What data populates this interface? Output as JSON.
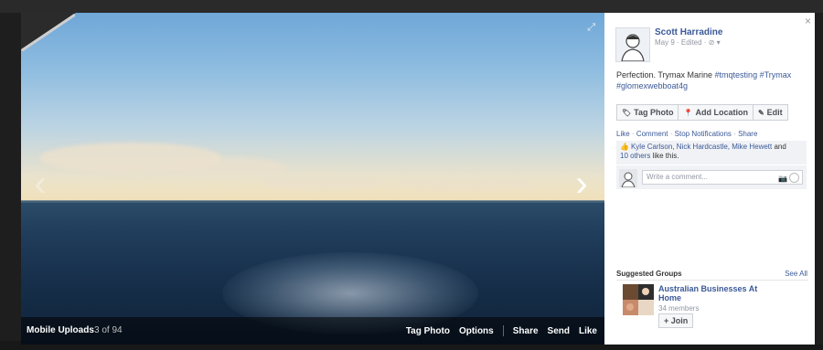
{
  "photo": {
    "album_label": "Mobile Uploads",
    "counter": "3 of 94",
    "actions": [
      "Tag Photo",
      "Options",
      "Share",
      "Send",
      "Like"
    ]
  },
  "post": {
    "author": "Scott Harradine",
    "meta": "May 9 · Edited · ⊘ ▾",
    "text_prefix": "Perfection. Trymax Marine ",
    "tags": [
      "#tmqtesting",
      "#Trymax",
      "#glomexwebboat4g"
    ],
    "buttons": {
      "tag_photo": "Tag Photo",
      "add_location": "Add Location",
      "edit": "Edit"
    },
    "actions": {
      "like": "Like",
      "comment": "Comment",
      "stop_notifications": "Stop Notifications",
      "share": "Share",
      "separator": "·"
    },
    "likes": {
      "names": "Kyle Carlson, Nick Hardcastle, Mike Hewett",
      "and": " and",
      "others": "10 others",
      "suffix": " like this."
    },
    "comment_placeholder": "Write a comment..."
  },
  "suggested_groups": {
    "title": "Suggested Groups",
    "see_all": "See All",
    "group": {
      "name": "Australian Businesses At Home",
      "members": "34 members",
      "join_label": "+ Join"
    }
  },
  "icons": {
    "close": "×",
    "expand": "⤢",
    "prev": "‹",
    "next": "›"
  }
}
